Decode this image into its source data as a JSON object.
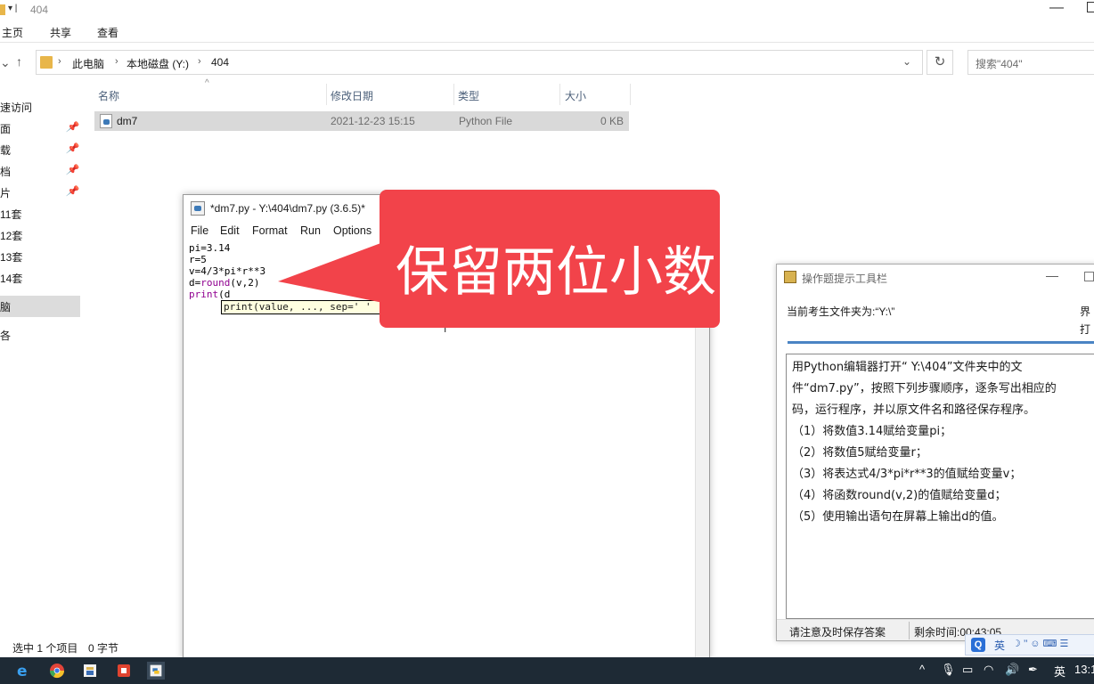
{
  "explorer": {
    "title": "404",
    "ribbon_tabs": [
      "主页",
      "共享",
      "查看"
    ],
    "breadcrumb": [
      "此电脑",
      "本地磁盘 (Y:)",
      "404"
    ],
    "search_placeholder": "搜索\"404\"",
    "nav_items": [
      {
        "label": "速访问",
        "pinned": false
      },
      {
        "label": "面",
        "pinned": true
      },
      {
        "label": "载",
        "pinned": true
      },
      {
        "label": "档",
        "pinned": true
      },
      {
        "label": "片",
        "pinned": true
      },
      {
        "label": "11套",
        "pinned": false
      },
      {
        "label": "12套",
        "pinned": false
      },
      {
        "label": "13套",
        "pinned": false
      },
      {
        "label": "14套",
        "pinned": false
      },
      {
        "label": "脑",
        "pinned": false,
        "selected": true
      },
      {
        "label": "各",
        "pinned": false
      }
    ],
    "columns": [
      "名称",
      "修改日期",
      "类型",
      "大小"
    ],
    "files": [
      {
        "name": "dm7",
        "modified": "2021-12-23 15:15",
        "type": "Python File",
        "size": "0 KB"
      }
    ],
    "status": {
      "selected": "选中 1 个项目",
      "size": "0 字节"
    }
  },
  "idle": {
    "title": "*dm7.py - Y:\\404\\dm7.py (3.6.5)*",
    "menu": [
      "File",
      "Edit",
      "Format",
      "Run",
      "Options"
    ],
    "code_lines": [
      {
        "plain": "pi=3.14"
      },
      {
        "plain": "r=5"
      },
      {
        "plain": "v=4/3*pi*r**3"
      },
      {
        "pre": "d=",
        "kw": "round",
        "post": "(v,2)"
      },
      {
        "pre": "",
        "kw": "print",
        "post": "(d"
      }
    ],
    "calltip": "print(value, ..., sep=' '"
  },
  "callout": {
    "text": "保留两位小数",
    "color": "#f2434a"
  },
  "toolbar": {
    "title": "操作题提示工具栏",
    "folder_label": "当前考生文件夹为:“Y:\\”",
    "right_link_1": "界",
    "right_link_2": "打",
    "instructions": [
      "用Python编辑器打开“ Y:\\404”文件夹中的文",
      "件“dm7.py”，按照下列步骤顺序，逐条写出相应的",
      "码，运行程序，并以原文件名和路径保存程序。",
      "（1）将数值3.14赋给变量pi；",
      "（2）将数值5赋给变量r；",
      "（3）将表达式4/3*pi*r**3的值赋给变量v；",
      "（4）将函数round(v,2)的值赋给变量d；",
      "（5）使用输出语句在屏幕上输出d的值。"
    ],
    "footer_left": "请注意及时保存答案",
    "footer_right": "剩余时间:00:43:05"
  },
  "ime": {
    "logo": "Q",
    "lang": "英",
    "extras": "☽ ’’ ☺ ⌨ ☰"
  },
  "taskbar": {
    "ime_lang": "英",
    "clock": "13:1",
    "apps": [
      "edge-icon",
      "chrome-icon",
      "explorer-app-icon",
      "red-app-icon",
      "python-idle-icon"
    ]
  }
}
